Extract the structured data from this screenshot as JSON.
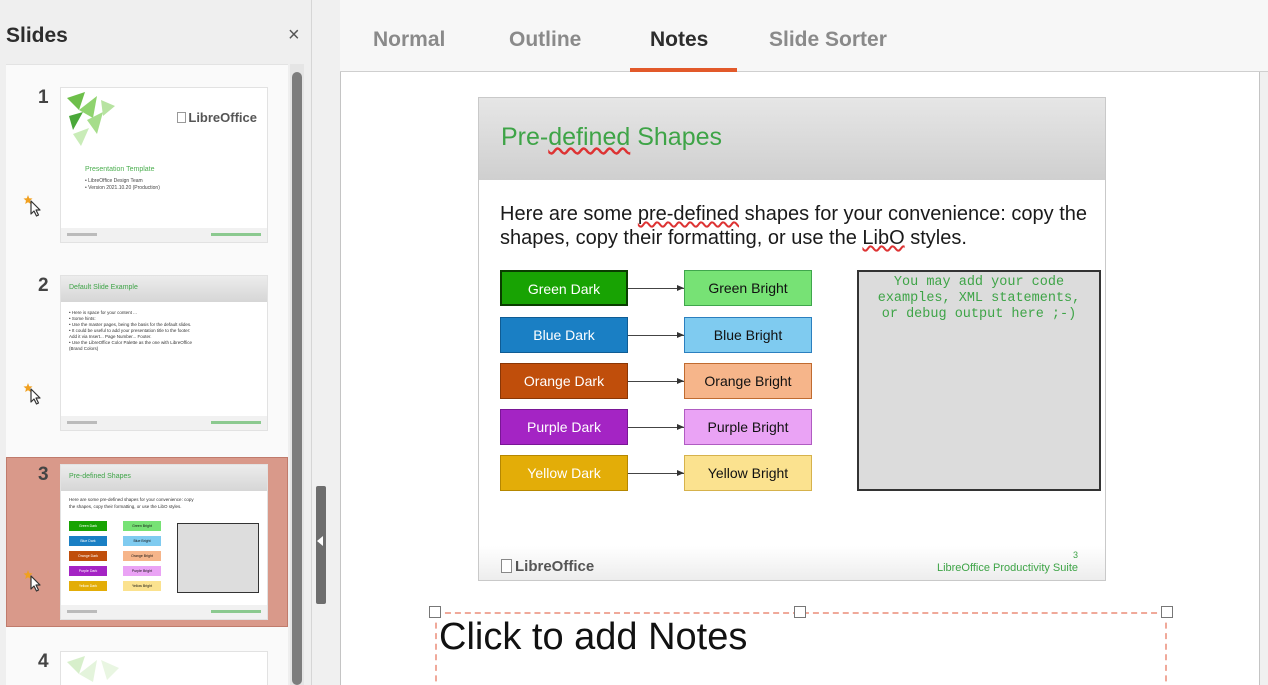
{
  "slides_pane": {
    "title": "Slides",
    "close_glyph": "×",
    "items": [
      {
        "number": "1",
        "logo_text": "LibreOffice",
        "title": "Presentation Template",
        "lines": [
          "• LibreOffice Design Team",
          "• Version 2021.10.20 (Production)"
        ]
      },
      {
        "number": "2",
        "title": "Default Slide Example",
        "lines": [
          "• Here is space for your content ...",
          "• Some hints:",
          "   • Use the master pages, being the basis for the default slides.",
          "   • It could be useful to add your presentation title to the footer:",
          "     Add it via Insert... Page Number... Footer.",
          "   • Use the LibreOffice Color Palette as the one with LibreOffice",
          "     (Brand Colors)"
        ]
      },
      {
        "number": "3",
        "title": "Pre-defined Shapes",
        "lines": [
          "Here are some pre-defined shapes for your convenience: copy",
          "the shapes, copy their formatting, or use the LibO styles."
        ]
      },
      {
        "number": "4"
      }
    ]
  },
  "tabs": [
    "Normal",
    "Outline",
    "Notes",
    "Slide Sorter"
  ],
  "active_tab": "Notes",
  "slide": {
    "title_prefix": "Pre-",
    "title_spell": "defined",
    "title_suffix": " Shapes",
    "body_1": "Here are some ",
    "body_spell_1": "pre-defined",
    "body_2": " shapes for your convenience: copy the shapes, copy their formatting, or use the ",
    "body_spell_2": "LibO",
    "body_3": " styles.",
    "shapes": [
      {
        "dark": "Green Dark",
        "bright": "Green Bright",
        "dark_color": "#18a303",
        "bright_color": "#77e275",
        "dark_border": "#0a3d00",
        "bright_border": "#3fa64c"
      },
      {
        "dark": "Blue Dark",
        "bright": "Blue Bright",
        "dark_color": "#1a7fc4",
        "bright_color": "#7fcbf0",
        "dark_border": "#0f5c94",
        "bright_border": "#2b7fbf"
      },
      {
        "dark": "Orange Dark",
        "bright": "Orange Bright",
        "dark_color": "#c04e0b",
        "bright_color": "#f6b58a",
        "dark_border": "#8a3605",
        "bright_border": "#c06b30"
      },
      {
        "dark": "Purple Dark",
        "bright": "Purple Bright",
        "dark_color": "#a424c4",
        "bright_color": "#eaa3f5",
        "dark_border": "#7a1696",
        "bright_border": "#b05cc2"
      },
      {
        "dark": "Yellow Dark",
        "bright": "Yellow Bright",
        "dark_color": "#e3ad08",
        "bright_color": "#fbe28f",
        "dark_border": "#b58700",
        "bright_border": "#d6b24c"
      }
    ],
    "code_text": "You may add your code\nexamples, XML statements,\nor debug output here ;-)",
    "footer_logo": "LibreOffice",
    "footer_text": "LibreOffice Productivity Suite",
    "slide_number": "3"
  },
  "notes_placeholder": "Click to add Notes",
  "colors": {
    "accent": "#e2592a",
    "selected_thumb": "#d9998a",
    "brand_green": "#3ea447"
  }
}
